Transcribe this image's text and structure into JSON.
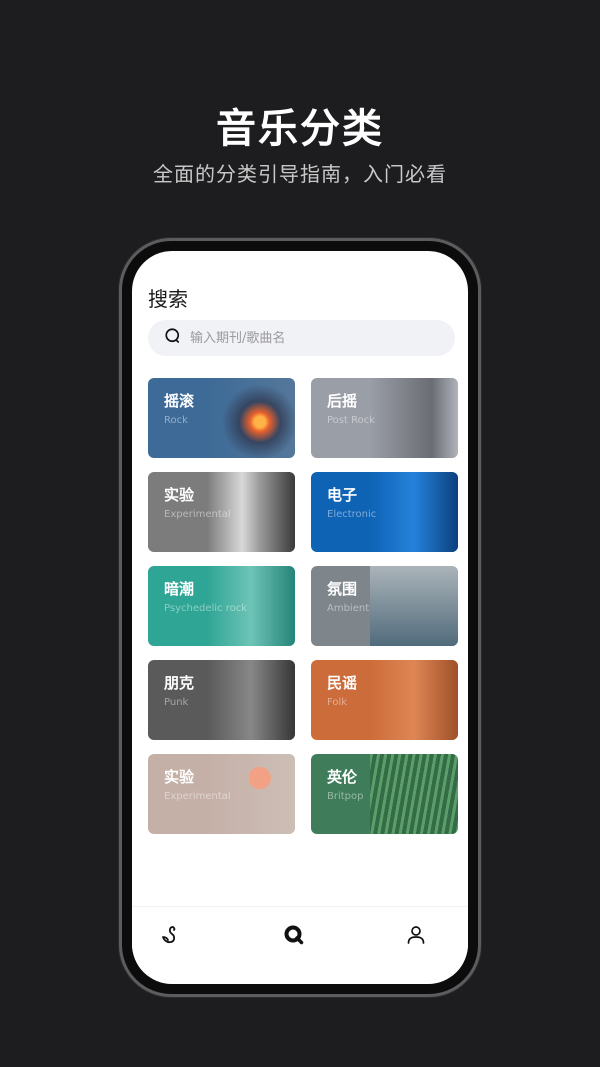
{
  "promo": {
    "title": "音乐分类",
    "subtitle": "全面的分类引导指南，入门必看"
  },
  "screen": {
    "page_title": "搜索",
    "search": {
      "placeholder": "输入期刊/歌曲名",
      "value": "",
      "icon": "search-icon"
    },
    "categories": [
      {
        "zh": "摇滚",
        "en": "Rock",
        "color": "#3d6a97"
      },
      {
        "zh": "后摇",
        "en": "Post Rock",
        "color": "#9a9ea7"
      },
      {
        "zh": "实验",
        "en": "Experimental",
        "color": "#7c7c7c"
      },
      {
        "zh": "电子",
        "en": "Electronic",
        "color": "#0e63b5"
      },
      {
        "zh": "暗潮",
        "en": "Psychedelic rock",
        "color": "#2fa595"
      },
      {
        "zh": "氛围",
        "en": "Ambient",
        "color": "#7e868b"
      },
      {
        "zh": "朋克",
        "en": "Punk",
        "color": "#5a5a5a"
      },
      {
        "zh": "民谣",
        "en": "Folk",
        "color": "#cc6c3a"
      },
      {
        "zh": "实验",
        "en": "Experimental",
        "color": "#c5b0a8"
      },
      {
        "zh": "英伦",
        "en": "Britpop",
        "color": "#3f7d5a"
      }
    ],
    "tabbar": [
      {
        "name": "swan-icon",
        "active": false
      },
      {
        "name": "search-tab-icon",
        "active": true
      },
      {
        "name": "user-icon",
        "active": false
      }
    ]
  }
}
